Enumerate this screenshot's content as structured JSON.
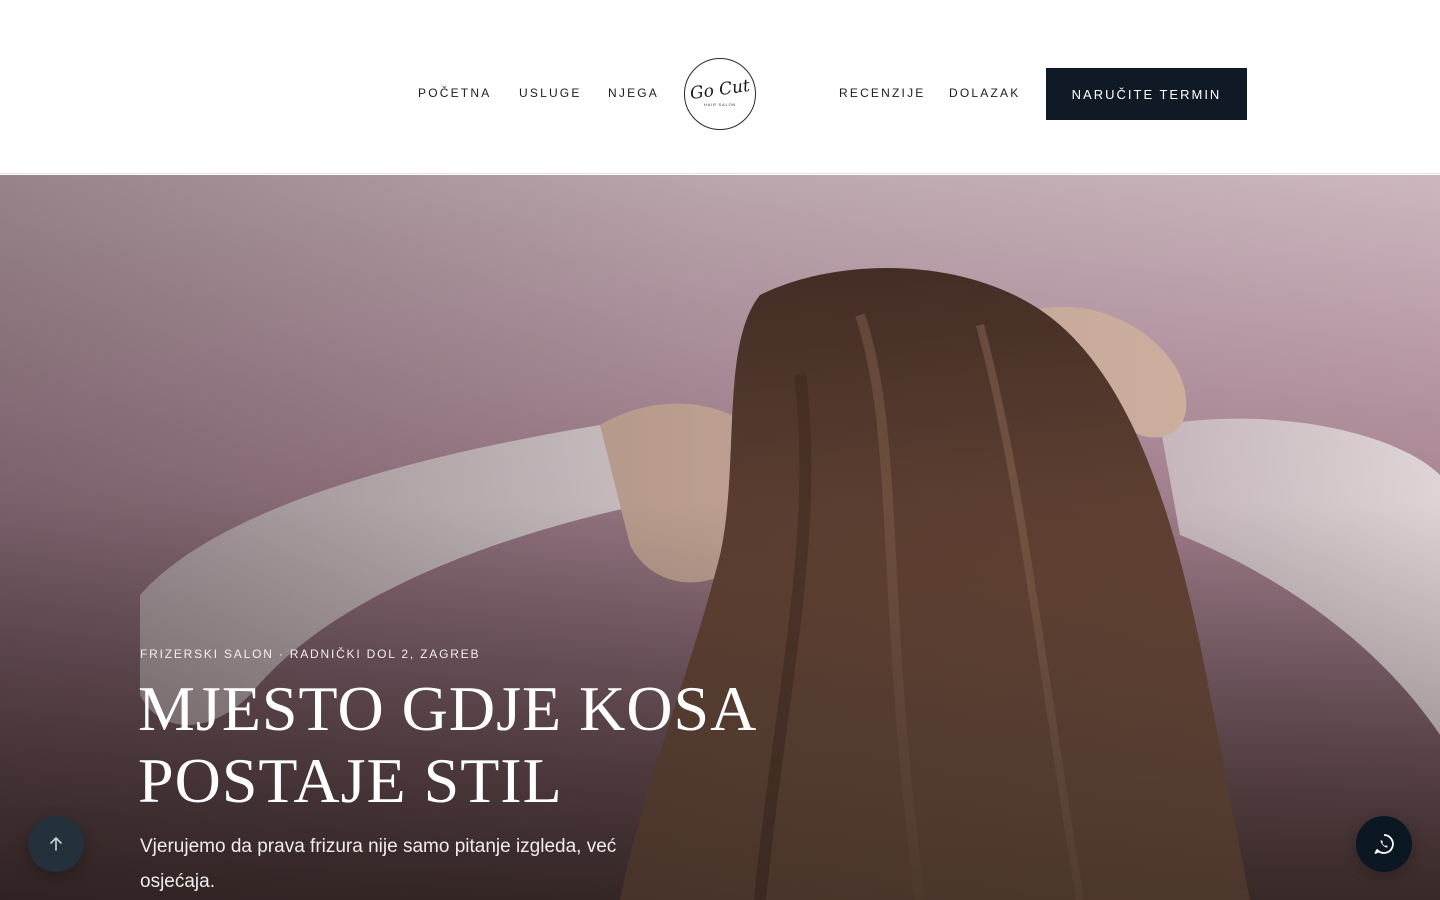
{
  "nav": {
    "left": [
      "POČETNA",
      "USLUGE",
      "NJEGA"
    ],
    "right": [
      "RECENZIJE",
      "DOLAZAK"
    ],
    "cta_label": "NARUČITE TERMIN"
  },
  "logo": {
    "script": "Go Cut",
    "sub": "HAIR SALON"
  },
  "hero": {
    "eyebrow": "FRIZERSKI SALON · RADNIČKI DOL 2, ZAGREB",
    "headline_line1": "MJESTO GDJE KOSA",
    "headline_line2": "POSTAJE STIL",
    "subtext": "Vjerujemo da prava frizura nije samo pitanje izgleda, već osjećaja."
  },
  "icons": {
    "scroll_top": "arrow-up-icon",
    "whatsapp": "whatsapp-icon"
  },
  "colors": {
    "cta_bg": "#0f1a26",
    "fab_top_bg": "#24303c",
    "fab_whatsapp_bg": "#0c1724",
    "hero_tint": "#c7a9b5"
  }
}
